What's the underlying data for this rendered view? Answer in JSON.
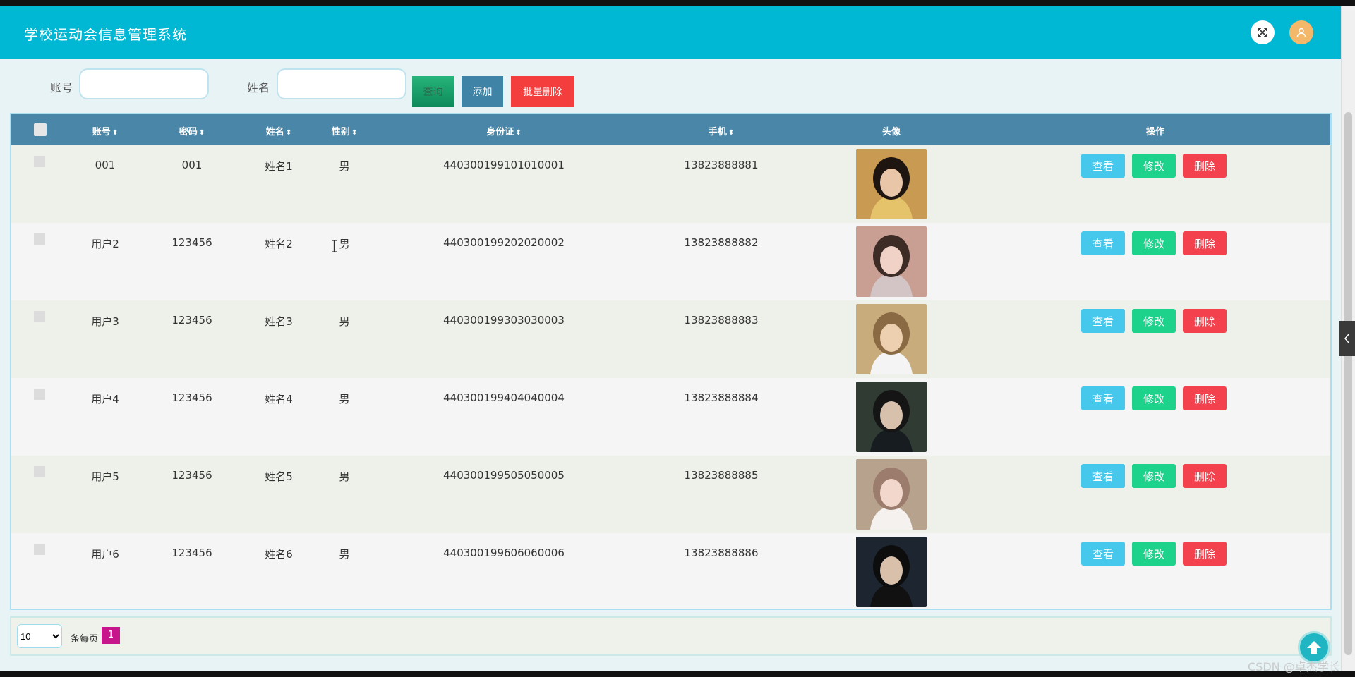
{
  "app": {
    "title": "学校运动会信息管理系统"
  },
  "search": {
    "account_label": "账号",
    "account_value": "",
    "name_label": "姓名",
    "name_value": "",
    "query_button": "查询",
    "add_button": "添加",
    "batch_delete_button": "批量删除"
  },
  "table": {
    "headers": {
      "account": "账号",
      "password": "密码",
      "name": "姓名",
      "gender": "性别",
      "id_card": "身份证",
      "phone": "手机",
      "avatar": "头像",
      "actions": "操作"
    },
    "rows": [
      {
        "account": "001",
        "password": "001",
        "name": "姓名1",
        "gender": "男",
        "id_card": "440300199101010001",
        "phone": "13823888881",
        "avatar_desc": "woman-long-hair"
      },
      {
        "account": "用户2",
        "password": "123456",
        "name": "姓名2",
        "gender": "男",
        "id_card": "440300199202020002",
        "phone": "13823888882",
        "avatar_desc": "woman-glasses"
      },
      {
        "account": "用户3",
        "password": "123456",
        "name": "姓名3",
        "gender": "男",
        "id_card": "440300199303030003",
        "phone": "13823888883",
        "avatar_desc": "young-man-track-jacket"
      },
      {
        "account": "用户4",
        "password": "123456",
        "name": "姓名4",
        "gender": "男",
        "id_card": "440300199404040004",
        "phone": "13823888884",
        "avatar_desc": "man-dark-night"
      },
      {
        "account": "用户5",
        "password": "123456",
        "name": "姓名5",
        "gender": "男",
        "id_card": "440300199505050005",
        "phone": "13823888885",
        "avatar_desc": "woman-bob-hair"
      },
      {
        "account": "用户6",
        "password": "123456",
        "name": "姓名6",
        "gender": "男",
        "id_card": "440300199606060006",
        "phone": "13823888886",
        "avatar_desc": "man-dark-portrait"
      }
    ],
    "row_actions": {
      "view": "查看",
      "edit": "修改",
      "delete": "删除"
    }
  },
  "pagination": {
    "page_size": "10",
    "per_page_label": "条每页",
    "current_page": "1"
  },
  "watermark": "CSDN @卓杰学长",
  "colors": {
    "header": "#00b8d4",
    "table_header": "#4a86a8",
    "view": "#45c8ec",
    "edit": "#1dd38c",
    "delete": "#f3414d",
    "page_active": "#c7168c"
  }
}
